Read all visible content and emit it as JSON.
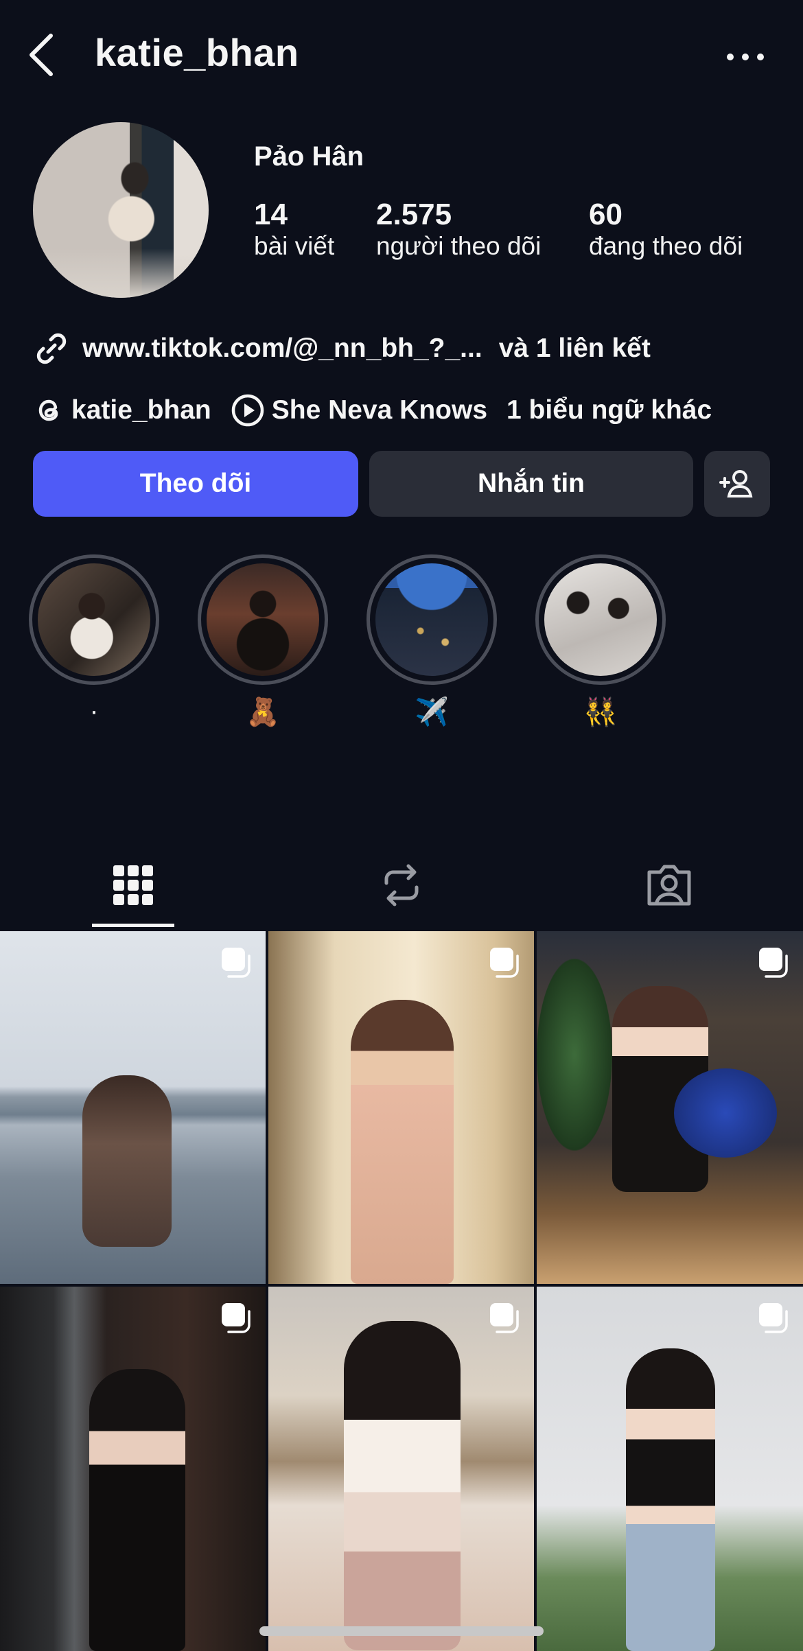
{
  "header": {
    "username": "katie_bhan",
    "back_icon": "chevron-left-icon",
    "more_icon": "more-horizontal-icon"
  },
  "profile": {
    "full_name": "Pảo Hân",
    "stats": [
      {
        "value": "14",
        "label": "bài viết"
      },
      {
        "value": "2.575",
        "label": "người theo dõi"
      },
      {
        "value": "60",
        "label": "đang theo dõi"
      }
    ],
    "link": {
      "icon": "link-icon",
      "url": "www.tiktok.com/@_nn_bh_?_...",
      "more": "và 1 liên kết"
    },
    "threads": {
      "icon": "threads-icon",
      "handle": "katie_bhan"
    },
    "music": {
      "icon": "play-circle-icon",
      "title": "She Neva Knows"
    },
    "more_badges": "1 biểu ngữ khác"
  },
  "actions": {
    "follow": "Theo dõi",
    "message": "Nhắn tin",
    "add_user_icon": "add-user-icon"
  },
  "highlights": [
    {
      "caption": "·"
    },
    {
      "caption": "🧸"
    },
    {
      "caption": "✈️"
    },
    {
      "caption": "👯"
    }
  ],
  "tabs": [
    {
      "name": "posts",
      "icon": "grid-icon",
      "active": true
    },
    {
      "name": "reposts",
      "icon": "repost-icon",
      "active": false
    },
    {
      "name": "tagged",
      "icon": "tagged-person-icon",
      "active": false
    }
  ],
  "colors": {
    "background": "#0c0f1a",
    "follow_button": "#4f5bf7",
    "secondary_button": "#2a2d37"
  }
}
